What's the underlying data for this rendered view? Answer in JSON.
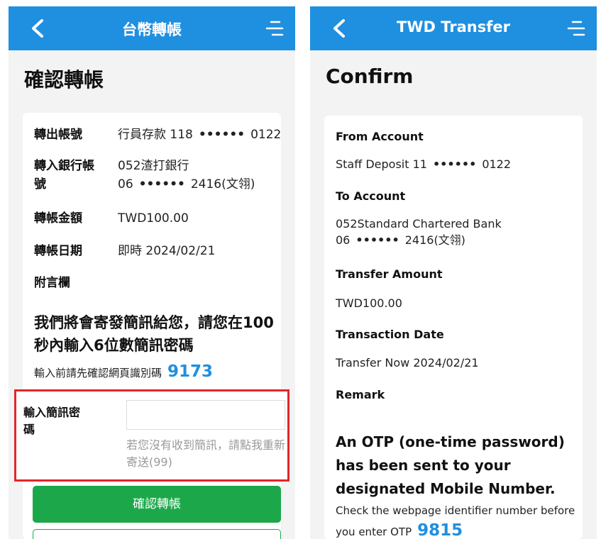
{
  "left": {
    "appbar_title": "台幣轉帳",
    "page_title": "確認轉帳",
    "rows": [
      {
        "label": "轉出帳號",
        "value_prefix": "行員存款 118",
        "value_mask": "••••••",
        "value_suffix": "0122"
      },
      {
        "label_line1": "轉入銀行帳",
        "label_line2": "號",
        "value_line1": "052渣打銀行",
        "value_line2_prefix": "06",
        "value_line2_mask": "••••••",
        "value_line2_suffix": "2416(文翎)"
      },
      {
        "label": "轉帳金額",
        "value": "TWD100.00"
      },
      {
        "label": "轉帳日期",
        "value": "即時 2024/02/21"
      },
      {
        "label": "附言欄",
        "value": ""
      }
    ],
    "notice": "我們將會寄發簡訊給您，請您在100秒內輸入6位數簡訊密碼",
    "hint_text": "輸入前請先確認網頁識別碼",
    "identifier_code": "9173",
    "otp": {
      "label_line1": "輸入簡訊密",
      "label_line2": "碼",
      "value": "",
      "resend_text": "若您沒有收到簡訊，請點我重新寄送(99)"
    },
    "confirm_button": "確認轉帳"
  },
  "right": {
    "appbar_title": "TWD Transfer",
    "page_title": "Confirm",
    "from_label": "From Account",
    "from_prefix": "Staff Deposit 11",
    "from_mask": "••••••",
    "from_suffix": "0122",
    "to_label": "To Account",
    "to_line1": "052Standard Chartered Bank",
    "to_line2_prefix": "06",
    "to_line2_mask": "••••••",
    "to_line2_suffix": "2416(文翎)",
    "amount_label": "Transfer Amount",
    "amount_value": "TWD100.00",
    "date_label": "Transaction Date",
    "date_value": "Transfer Now 2024/02/21",
    "remark_label": "Remark",
    "notice": "An OTP (one-time password) has been sent to your designated Mobile Number.",
    "hint_text": "Check the webpage identifier number before you enter OTP",
    "identifier_code": "9815"
  },
  "colors": {
    "appbar": "#1f8fe0",
    "confirm_button": "#1ca84a",
    "highlight_border": "#e3262a",
    "code": "#1f8fe0"
  },
  "icons": [
    "back-icon",
    "menu-icon"
  ]
}
